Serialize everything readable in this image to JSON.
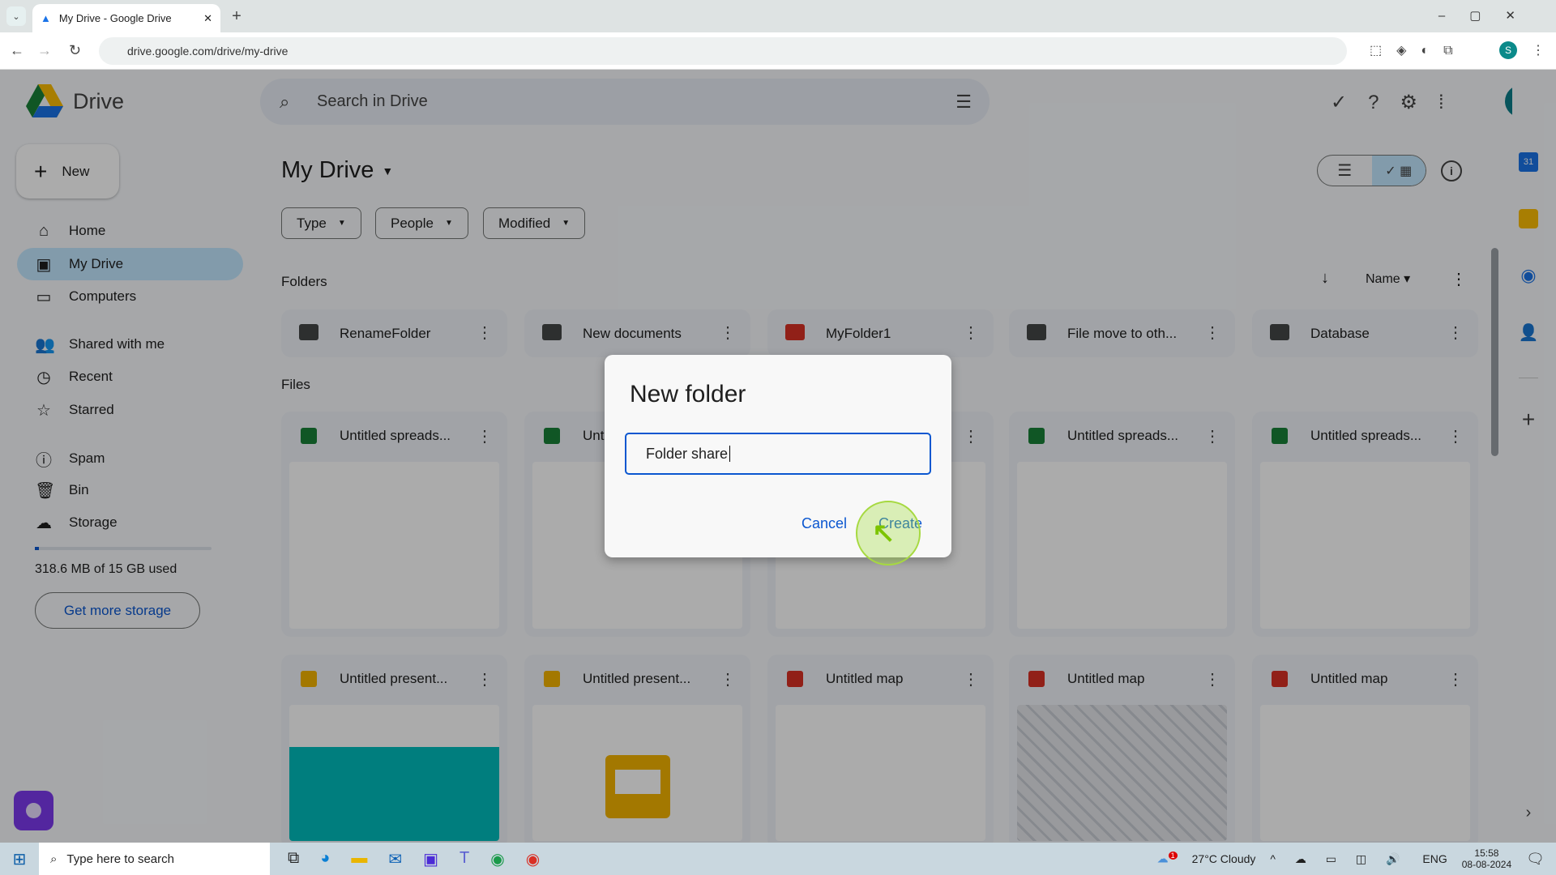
{
  "browser": {
    "tab_title": "My Drive - Google Drive",
    "url": "drive.google.com/drive/my-drive"
  },
  "header": {
    "app_name": "Drive",
    "search_placeholder": "Search in Drive",
    "avatar_letter": "S"
  },
  "sidebar": {
    "new_label": "New",
    "items": [
      {
        "label": "Home",
        "icon": "home-icon"
      },
      {
        "label": "My Drive",
        "icon": "drive-icon",
        "active": true
      },
      {
        "label": "Computers",
        "icon": "computer-icon"
      },
      {
        "label": "Shared with me",
        "icon": "people-icon"
      },
      {
        "label": "Recent",
        "icon": "clock-icon"
      },
      {
        "label": "Starred",
        "icon": "star-icon"
      },
      {
        "label": "Spam",
        "icon": "spam-icon"
      },
      {
        "label": "Bin",
        "icon": "trash-icon"
      },
      {
        "label": "Storage",
        "icon": "cloud-icon"
      }
    ],
    "storage_text": "318.6 MB of 15 GB used",
    "storage_fraction": 0.021,
    "get_storage_label": "Get more storage"
  },
  "main": {
    "title": "My Drive",
    "filters": [
      "Type",
      "People",
      "Modified"
    ],
    "folders_label": "Folders",
    "files_label": "Files",
    "sort_label": "Name",
    "folders": [
      {
        "name": "RenameFolder",
        "color": "#444746"
      },
      {
        "name": "New documents",
        "color": "#444746"
      },
      {
        "name": "MyFolder1",
        "color": "#d93025"
      },
      {
        "name": "File move to oth...",
        "color": "#444746"
      },
      {
        "name": "Database",
        "color": "#444746"
      }
    ],
    "files": [
      {
        "name": "Untitled spreads...",
        "type": "sheet"
      },
      {
        "name": "Untitled spreads...",
        "type": "sheet"
      },
      {
        "name": "",
        "type": "sheet"
      },
      {
        "name": "Untitled spreads...",
        "type": "sheet"
      },
      {
        "name": "Untitled spreads...",
        "type": "sheet"
      },
      {
        "name": "Untitled present...",
        "type": "slides"
      },
      {
        "name": "Untitled present...",
        "type": "slides"
      },
      {
        "name": "Untitled map",
        "type": "map"
      },
      {
        "name": "Untitled map",
        "type": "map"
      },
      {
        "name": "Untitled map",
        "type": "map"
      }
    ]
  },
  "dialog": {
    "title": "New folder",
    "input_value": "Folder share",
    "cancel_label": "Cancel",
    "create_label": "Create"
  },
  "taskbar": {
    "search_placeholder": "Type here to search",
    "weather": "27°C  Cloudy",
    "weather_badge": "1",
    "lang": "ENG",
    "time": "15:58",
    "date": "08-08-2024"
  },
  "colors": {
    "accent": "#0b57d0",
    "active_nav": "#c2e7ff",
    "sheet": "#188038",
    "slides": "#f4b400",
    "map": "#d93025"
  }
}
